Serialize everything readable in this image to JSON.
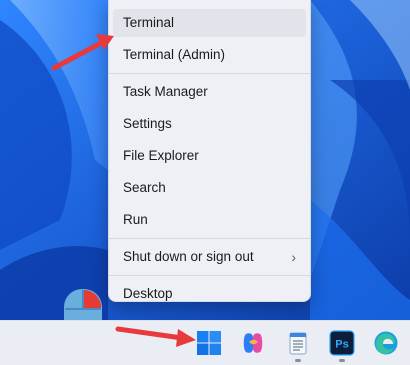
{
  "context_menu": {
    "items": [
      {
        "label": "Terminal"
      },
      {
        "label": "Terminal (Admin)"
      },
      {
        "label": "Task Manager"
      },
      {
        "label": "Settings"
      },
      {
        "label": "File Explorer"
      },
      {
        "label": "Search"
      },
      {
        "label": "Run"
      },
      {
        "label": "Shut down or sign out",
        "submenu_icon": "chevron-right-icon"
      },
      {
        "label": "Desktop"
      }
    ],
    "highlighted_item": "Terminal"
  },
  "taskbar": {
    "apps": [
      {
        "name": "start-button",
        "icon": "windows-logo-icon"
      },
      {
        "name": "copilot",
        "icon": "copilot-icon"
      },
      {
        "name": "notepad",
        "icon": "notepad-icon"
      },
      {
        "name": "photoshop",
        "icon": "photoshop-icon",
        "text": "Ps"
      },
      {
        "name": "edge",
        "icon": "edge-icon"
      }
    ]
  },
  "annotations": {
    "arrow_color": "#e8393c",
    "mouse_icon": "mouse-right-click-icon"
  },
  "colors": {
    "wallpaper_blue": "#1a63d8",
    "menu_bg": "#eef0f5",
    "taskbar_bg": "#eaeef4",
    "windows_blue": "#1a7ff0"
  }
}
